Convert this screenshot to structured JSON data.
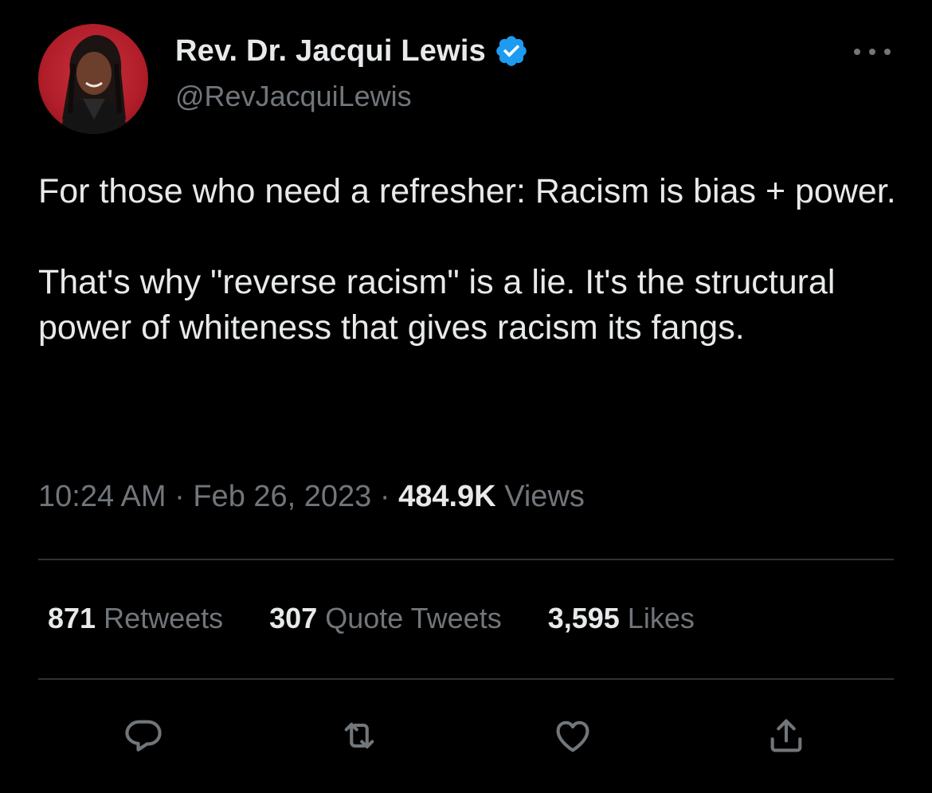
{
  "user": {
    "display_name": "Rev. Dr. Jacqui Lewis",
    "handle": "@RevJacquiLewis",
    "verified": true,
    "avatar_icon": "profile-photo"
  },
  "tweet": {
    "paragraphs": [
      "For those who need a refresher: Racism is bias + power.",
      "That's why \"reverse racism\" is a lie. It's the structural power of whiteness that gives racism its fangs."
    ]
  },
  "meta": {
    "time": "10:24 AM",
    "separator": "·",
    "date": "Feb 26, 2023",
    "views_count": "484.9K",
    "views_label": "Views"
  },
  "stats": {
    "retweets_count": "871",
    "retweets_label": "Retweets",
    "quotes_count": "307",
    "quotes_label": "Quote Tweets",
    "likes_count": "3,595",
    "likes_label": "Likes"
  },
  "actions": [
    {
      "name": "reply",
      "icon": "reply-icon"
    },
    {
      "name": "retweet",
      "icon": "retweet-icon"
    },
    {
      "name": "like",
      "icon": "heart-icon"
    },
    {
      "name": "share",
      "icon": "share-icon"
    }
  ],
  "colors": {
    "background": "#000000",
    "primary_text": "#e7e9ea",
    "secondary_text": "#71767b",
    "divider": "#2f3336",
    "verified_blue": "#1d9bf0"
  }
}
